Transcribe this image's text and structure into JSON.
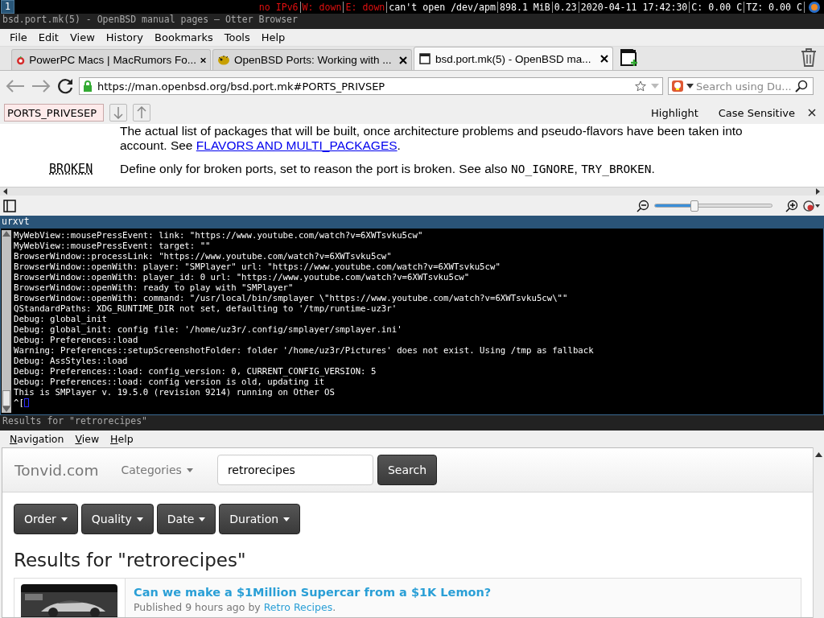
{
  "top_bar": {
    "workspace": "1",
    "segments": [
      {
        "text": "no IPv6",
        "alert": true
      },
      {
        "text": "W: down",
        "alert": true
      },
      {
        "text": "E: down",
        "alert": true
      },
      {
        "text": "can't open /dev/apm",
        "alert": false
      },
      {
        "text": "898.1 MiB",
        "alert": false
      },
      {
        "text": "0.23",
        "alert": false
      },
      {
        "text": "2020-04-11 17:42:30",
        "alert": false
      },
      {
        "text": "C: 0.00 C",
        "alert": false
      },
      {
        "text": "TZ: 0.00 C",
        "alert": false
      }
    ]
  },
  "browser": {
    "title": "bsd.port.mk(5) - OpenBSD manual pages — Otter Browser",
    "menu": [
      "File",
      "Edit",
      "View",
      "History",
      "Bookmarks",
      "Tools",
      "Help"
    ],
    "tabs": [
      {
        "label": "PowerPC Macs | MacRumors Fo...",
        "selected": false
      },
      {
        "label": "OpenBSD Ports: Working with ...",
        "selected": false
      },
      {
        "label": "bsd.port.mk(5) - OpenBSD ma...",
        "selected": true
      }
    ],
    "address": "https://man.openbsd.org/bsd.port.mk#PORTS_PRIVSEP",
    "search": {
      "placeholder": "Search using Du..."
    },
    "find_bar": {
      "value": "PORTS_PRIVESEP",
      "options": [
        "Highlight",
        "Case Sensitive"
      ]
    },
    "content": {
      "paragraph": "The actual list of packages that will be built, once architecture problems and pseudo-flavors have been taken into account. See ",
      "link": "FLAVORS AND MULTI_PACKAGES",
      "paragraph_end": ".",
      "entry": {
        "term": "BROKEN",
        "parts": [
          {
            "text": "Define only for broken ports, set to reason the port is broken. See also ",
            "code": false
          },
          {
            "text": "NO_IGNORE",
            "code": true
          },
          {
            "text": ", ",
            "code": false
          },
          {
            "text": "TRY_BROKEN",
            "code": true
          },
          {
            "text": ".",
            "code": false
          }
        ]
      }
    },
    "zoom": {
      "level": 0.34
    }
  },
  "terminal": {
    "title": "urxvt",
    "lines": [
      "MyWebView::mousePressEvent: link: \"https://www.youtube.com/watch?v=6XWTsvku5cw\"",
      "MyWebView::mousePressEvent: target: \"\"",
      "BrowserWindow::processLink: \"https://www.youtube.com/watch?v=6XWTsvku5cw\"",
      "BrowserWindow::openWith: player: \"SMPlayer\" url: \"https://www.youtube.com/watch?v=6XWTsvku5cw\"",
      "BrowserWindow::openWith: player_id: 0 url: \"https://www.youtube.com/watch?v=6XWTsvku5cw\"",
      "BrowserWindow::openWith: ready to play with \"SMPlayer\"",
      "BrowserWindow::openWith: command: \"/usr/local/bin/smplayer \\\"https://www.youtube.com/watch?v=6XWTsvku5cw\\\"\"",
      "QStandardPaths: XDG_RUNTIME_DIR not set, defaulting to '/tmp/runtime-uz3r'",
      "Debug: global_init",
      "Debug: global_init: config file: '/home/uz3r/.config/smplayer/smplayer.ini'",
      "Debug: Preferences::load",
      "Warning: Preferences::setupScreenshotFolder: folder '/home/uz3r/Pictures' does not exist. Using /tmp as fallback",
      "Debug: AssStyles::load",
      "Debug: Preferences::load: config_version: 0, CURRENT_CONFIG_VERSION: 5",
      "Debug: Preferences::load: config version is old, updating it",
      "This is SMPlayer v. 19.5.0 (revision 9214) running on Other OS"
    ],
    "prompt": "^["
  },
  "player": {
    "title": "Results for \"retrorecipes\"",
    "menu": [
      "Navigation",
      "View",
      "Help"
    ],
    "site": {
      "brand": "Tonvid.com",
      "categories": "Categories",
      "search_value": "retrorecipes",
      "search_button": "Search"
    },
    "filters": [
      "Order",
      "Quality",
      "Date",
      "Duration"
    ],
    "heading": "Results for \"retrorecipes\"",
    "results": [
      {
        "kind": "picture",
        "title": "Can we make a $1Million Supercar from a $1K Lemon?",
        "published": "Published 9 hours ago by ",
        "author": "Retro Recipes",
        "end": "."
      }
    ]
  }
}
